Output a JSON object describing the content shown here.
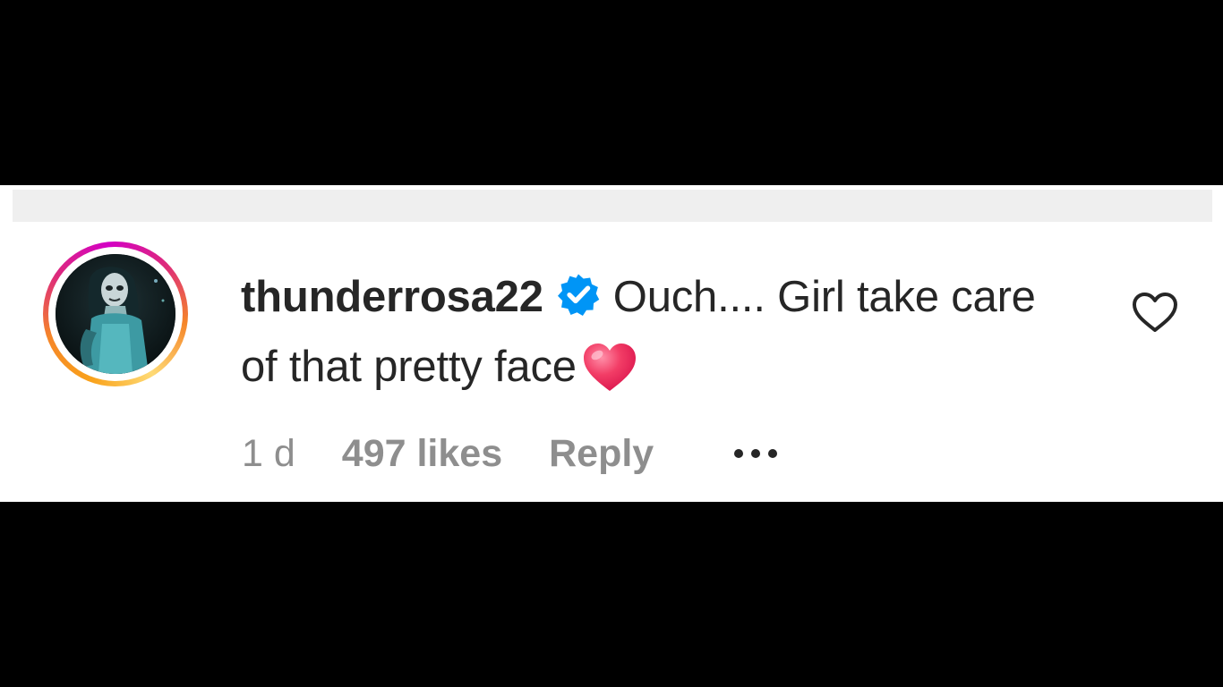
{
  "comment": {
    "username": "thunderrosa22",
    "text": "Ouch.... Girl take care of that pretty face",
    "time": "1 d",
    "likes": "497 likes",
    "reply_label": "Reply",
    "verified": true
  },
  "icons": {
    "verified": "verified-badge-icon",
    "emoji": "red-heart-emoji",
    "like": "heart-outline-icon",
    "more": "more-options-icon"
  },
  "colors": {
    "verified_blue": "#0095f6",
    "text_primary": "#262626",
    "text_secondary": "#8e8e8e",
    "emoji_red": "#f0325a"
  }
}
